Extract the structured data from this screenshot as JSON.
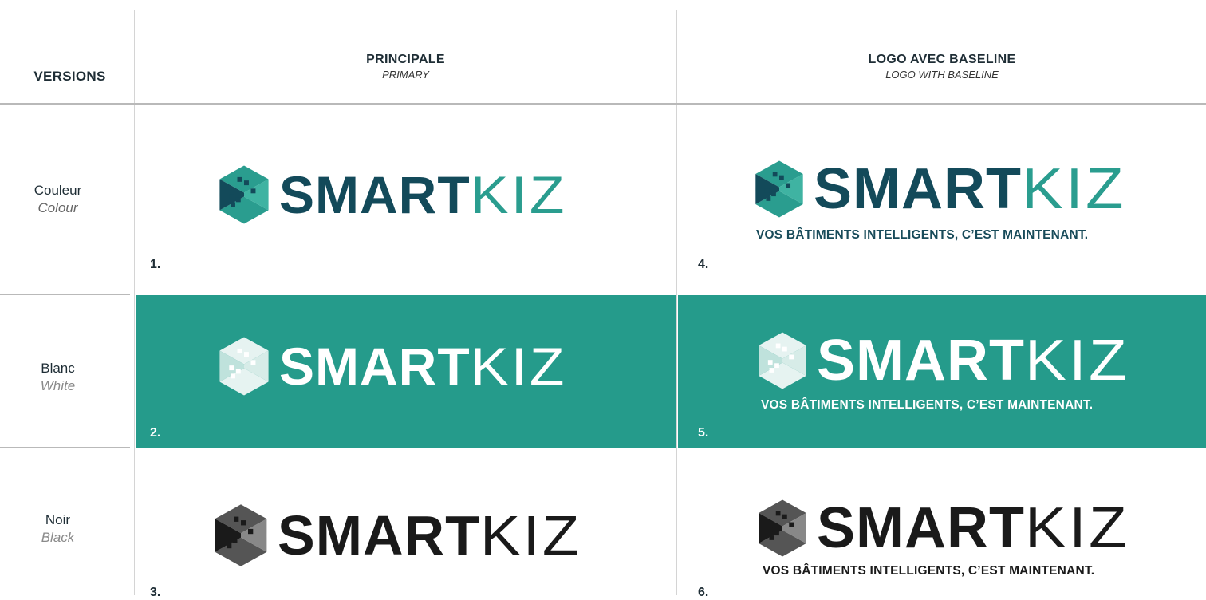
{
  "header": {
    "versions_label": "VERSIONS",
    "col1": {
      "title": "PRINCIPALE",
      "subtitle": "PRIMARY"
    },
    "col2": {
      "title": "LOGO AVEC BASELINE",
      "subtitle": "LOGO WITH BASELINE"
    }
  },
  "rows": [
    {
      "label_fr": "Couleur",
      "label_en": "Colour",
      "num_primary": "1.",
      "num_baseline": "4."
    },
    {
      "label_fr": "Blanc",
      "label_en": "White",
      "num_primary": "2.",
      "num_baseline": "5."
    },
    {
      "label_fr": "Noir",
      "label_en": "Black",
      "num_primary": "3.",
      "num_baseline": "6."
    }
  ],
  "logo": {
    "bold": "SMART",
    "thin": "KIZ",
    "baseline": "VOS BÂTIMENTS INTELLIGENTS, C’EST MAINTENANT."
  },
  "colors": {
    "navy": "#134a5a",
    "teal": "#2a9d8f",
    "band": "#259b8b",
    "black": "#1a1a1a",
    "baseline_navy": "#184b5a"
  }
}
